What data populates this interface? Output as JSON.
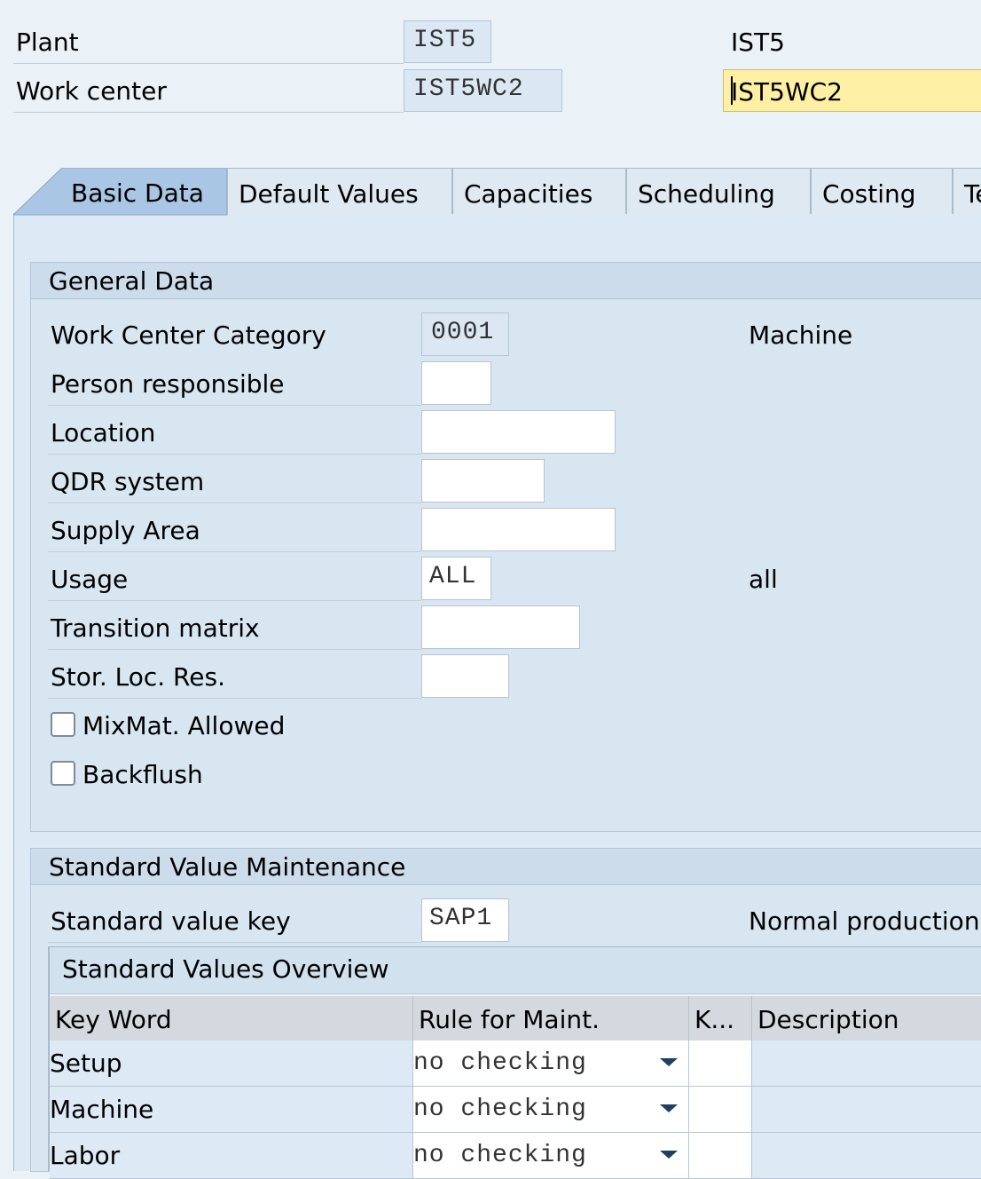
{
  "header": {
    "plant_label": "Plant",
    "plant_value": "IST5",
    "plant_desc": "IST5",
    "workcenter_label": "Work center",
    "workcenter_value": "IST5WC2",
    "workcenter_desc": "IST5WC2"
  },
  "tabs": [
    {
      "label": "Basic Data",
      "active": true
    },
    {
      "label": "Default Values"
    },
    {
      "label": "Capacities"
    },
    {
      "label": "Scheduling"
    },
    {
      "label": "Costing"
    },
    {
      "label": "Te"
    }
  ],
  "general_data": {
    "title": "General Data",
    "fields": [
      {
        "label": "Work Center Category",
        "value": "0001",
        "desc": "Machine"
      },
      {
        "label": "Person responsible",
        "value": ""
      },
      {
        "label": "Location",
        "value": ""
      },
      {
        "label": "QDR system",
        "value": ""
      },
      {
        "label": "Supply Area",
        "value": ""
      },
      {
        "label": "Usage",
        "value": "ALL",
        "desc": "all"
      },
      {
        "label": "Transition matrix",
        "value": ""
      },
      {
        "label": "Stor. Loc. Res.",
        "value": ""
      }
    ],
    "checkboxes": [
      {
        "label": "MixMat. Allowed",
        "checked": false
      },
      {
        "label": "Backflush",
        "checked": false
      }
    ]
  },
  "standard_value": {
    "title": "Standard Value Maintenance",
    "key_label": "Standard value key",
    "key_value": "SAP1",
    "key_desc": "Normal production",
    "overview_title": "Standard Values Overview",
    "columns": [
      "Key Word",
      "Rule for Maint.",
      "K...",
      "Description"
    ],
    "rows": [
      {
        "key_word": "Setup",
        "rule": "no checking",
        "k": "",
        "description": ""
      },
      {
        "key_word": "Machine",
        "rule": "no checking",
        "k": "",
        "description": ""
      },
      {
        "key_word": "Labor",
        "rule": "no checking",
        "k": "",
        "description": ""
      }
    ]
  },
  "colors": {
    "focused_field": "#fdf0a4",
    "background": "#eaf1f7",
    "panel": "#dde9f4",
    "active_tab": "#a9c6e4"
  }
}
